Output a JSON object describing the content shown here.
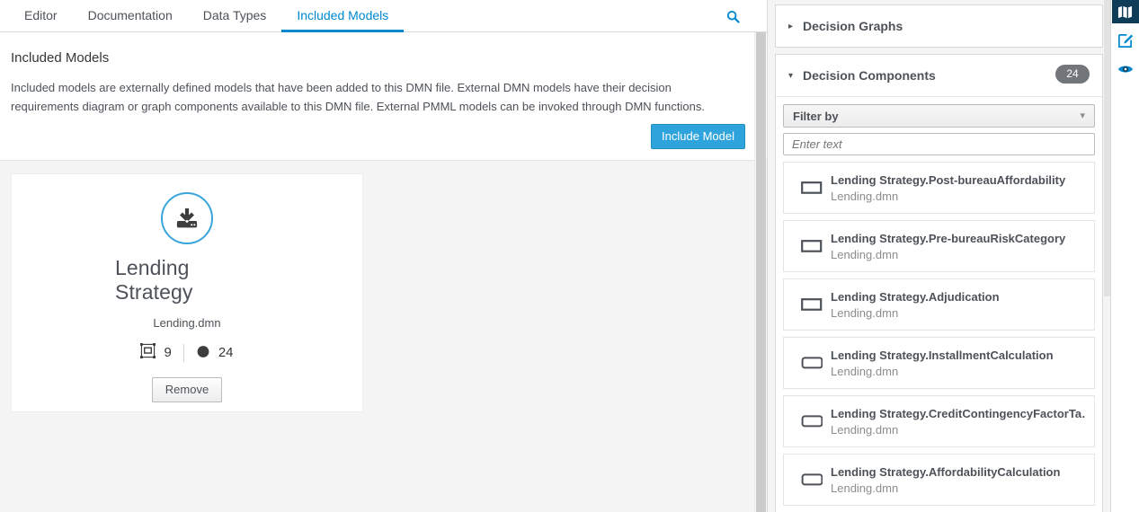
{
  "tabs": [
    {
      "label": "Editor",
      "active": false
    },
    {
      "label": "Documentation",
      "active": false
    },
    {
      "label": "Data Types",
      "active": false
    },
    {
      "label": "Included Models",
      "active": true
    }
  ],
  "search": {
    "icon": "search-icon"
  },
  "main": {
    "heading": "Included Models",
    "description": "Included models are externally defined models that have been added to this DMN file. External DMN models have their decision requirements diagram or graph components available to this DMN file. External PMML models can be invoked through DMN functions.",
    "include_button": "Include Model",
    "card": {
      "icon": "import-download-icon",
      "name": "Lending Strategy",
      "file": "Lending.dmn",
      "stats": [
        {
          "icon": "drd-nodes-icon",
          "value": "9"
        },
        {
          "icon": "decision-dot-icon",
          "value": "24"
        }
      ],
      "remove_button": "Remove"
    }
  },
  "right_panel": {
    "decision_graphs": {
      "title": "Decision Graphs",
      "expanded": false,
      "caret": "▸"
    },
    "decision_components": {
      "title": "Decision Components",
      "expanded": true,
      "caret": "▾",
      "badge": "24",
      "filter_label": "Filter by",
      "filter_placeholder": "Enter text",
      "filter_value": "",
      "items": [
        {
          "name": "Lending Strategy.Post-bureauAffordability",
          "file": "Lending.dmn",
          "icon": "decision-rect-icon"
        },
        {
          "name": "Lending Strategy.Pre-bureauRiskCategory",
          "file": "Lending.dmn",
          "icon": "decision-rect-icon"
        },
        {
          "name": "Lending Strategy.Adjudication",
          "file": "Lending.dmn",
          "icon": "decision-rect-icon"
        },
        {
          "name": "Lending Strategy.InstallmentCalculation",
          "file": "Lending.dmn",
          "icon": "bkm-rounded-rect-icon"
        },
        {
          "name": "Lending Strategy.CreditContingencyFactorTa…",
          "file": "Lending.dmn",
          "icon": "bkm-rounded-rect-icon"
        },
        {
          "name": "Lending Strategy.AffordabilityCalculation",
          "file": "Lending.dmn",
          "icon": "bkm-rounded-rect-icon"
        }
      ]
    }
  },
  "icon_rail": [
    {
      "icon": "map-icon",
      "active": true
    },
    {
      "icon": "pencil-edit-icon",
      "active": false
    },
    {
      "icon": "eye-preview-icon",
      "active": false
    }
  ],
  "colors": {
    "accent_blue": "#0088ce",
    "button_blue": "#2fa4dc",
    "badge_gray": "#72767b",
    "rail_active": "#0f3c57",
    "text_dark": "#4d5258"
  }
}
